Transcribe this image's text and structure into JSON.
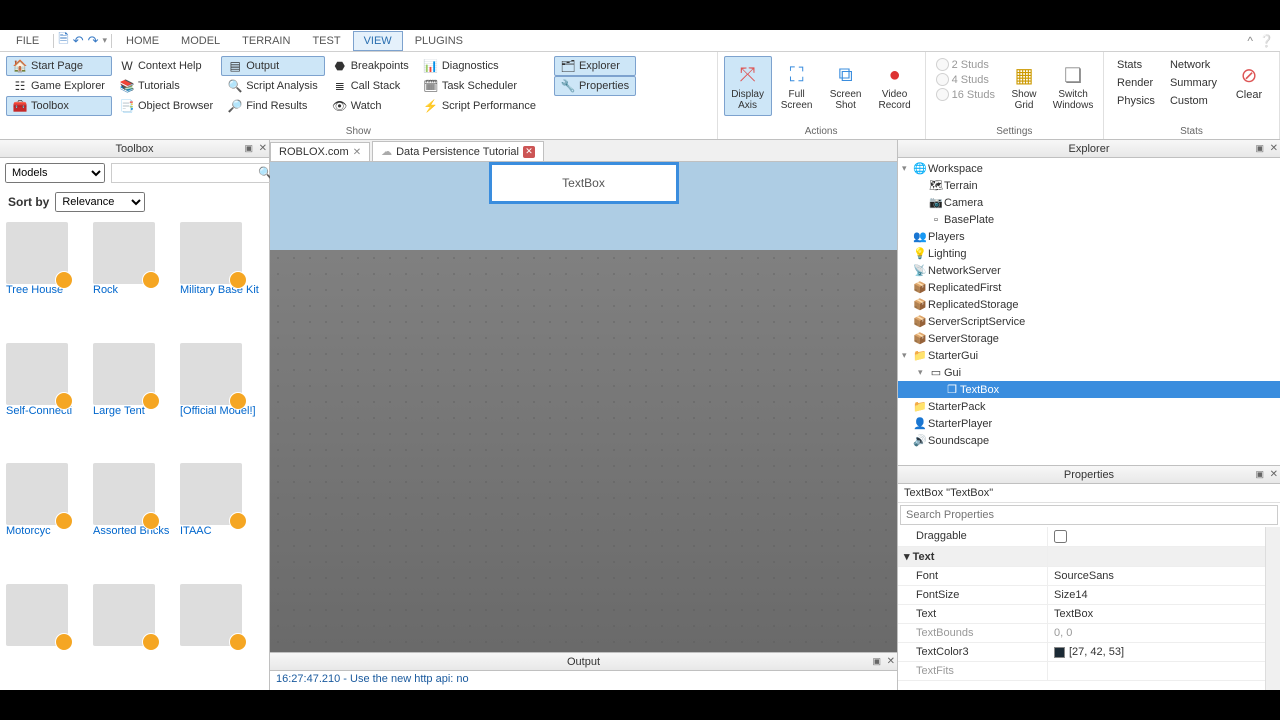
{
  "menu": {
    "file": "FILE",
    "home": "HOME",
    "model": "MODEL",
    "terrain": "TERRAIN",
    "test": "TEST",
    "view": "VIEW",
    "plugins": "PLUGINS"
  },
  "ribbon": {
    "show": {
      "label": "Show",
      "start_page": "Start Page",
      "context_help": "Context Help",
      "output": "Output",
      "breakpoints": "Breakpoints",
      "diagnostics": "Diagnostics",
      "game_explorer": "Game Explorer",
      "tutorials": "Tutorials",
      "script_analysis": "Script Analysis",
      "call_stack": "Call Stack",
      "task_scheduler": "Task Scheduler",
      "toolbox": "Toolbox",
      "object_browser": "Object Browser",
      "find_results": "Find Results",
      "watch": "Watch",
      "script_performance": "Script Performance",
      "explorer": "Explorer",
      "properties": "Properties"
    },
    "actions": {
      "label": "Actions",
      "display_axis": "Display\nAxis",
      "full_screen": "Full\nScreen",
      "screen_shot": "Screen\nShot",
      "video_record": "Video\nRecord"
    },
    "settings": {
      "label": "Settings",
      "studs2": "2 Studs",
      "studs4": "4 Studs",
      "studs16": "16 Studs",
      "show_grid": "Show\nGrid",
      "switch_windows": "Switch\nWindows"
    },
    "stats": {
      "label": "Stats",
      "stats": "Stats",
      "network": "Network",
      "render": "Render",
      "summary": "Summary",
      "physics": "Physics",
      "custom": "Custom",
      "clear": "Clear"
    }
  },
  "tabs": {
    "roblox": "ROBLOX.com",
    "tutorial": "Data Persistence Tutorial"
  },
  "toolbox": {
    "title": "Toolbox",
    "category": "Models",
    "sort_label": "Sort by",
    "sort_value": "Relevance",
    "items": [
      {
        "label": "Tree House"
      },
      {
        "label": "Rock"
      },
      {
        "label": "Military Base Kit"
      },
      {
        "label": "Self-Connecti"
      },
      {
        "label": "Large Tent"
      },
      {
        "label": "[Official Model!]"
      },
      {
        "label": "Motorcyc"
      },
      {
        "label": "Assorted Bricks"
      },
      {
        "label": "ITAAC"
      },
      {
        "label": ""
      },
      {
        "label": ""
      },
      {
        "label": ""
      }
    ]
  },
  "viewport": {
    "textbox": "TextBox"
  },
  "output": {
    "title": "Output",
    "line": "16:27:47.210 - Use the new http api: no"
  },
  "explorer": {
    "title": "Explorer",
    "tree": [
      {
        "label": "Workspace",
        "indent": 0,
        "arrow": "▾",
        "icon": "🌐"
      },
      {
        "label": "Terrain",
        "indent": 1,
        "arrow": "",
        "icon": "🗺"
      },
      {
        "label": "Camera",
        "indent": 1,
        "arrow": "",
        "icon": "📷"
      },
      {
        "label": "BasePlate",
        "indent": 1,
        "arrow": "",
        "icon": "▫"
      },
      {
        "label": "Players",
        "indent": 0,
        "arrow": "",
        "icon": "👥"
      },
      {
        "label": "Lighting",
        "indent": 0,
        "arrow": "",
        "icon": "💡"
      },
      {
        "label": "NetworkServer",
        "indent": 0,
        "arrow": "",
        "icon": "📡"
      },
      {
        "label": "ReplicatedFirst",
        "indent": 0,
        "arrow": "",
        "icon": "📦"
      },
      {
        "label": "ReplicatedStorage",
        "indent": 0,
        "arrow": "",
        "icon": "📦"
      },
      {
        "label": "ServerScriptService",
        "indent": 0,
        "arrow": "",
        "icon": "📦"
      },
      {
        "label": "ServerStorage",
        "indent": 0,
        "arrow": "",
        "icon": "📦"
      },
      {
        "label": "StarterGui",
        "indent": 0,
        "arrow": "▾",
        "icon": "📁"
      },
      {
        "label": "Gui",
        "indent": 1,
        "arrow": "▾",
        "icon": "▭"
      },
      {
        "label": "TextBox",
        "indent": 2,
        "arrow": "",
        "icon": "❐",
        "selected": true
      },
      {
        "label": "StarterPack",
        "indent": 0,
        "arrow": "",
        "icon": "📁"
      },
      {
        "label": "StarterPlayer",
        "indent": 0,
        "arrow": "",
        "icon": "👤"
      },
      {
        "label": "Soundscape",
        "indent": 0,
        "arrow": "",
        "icon": "🔊"
      }
    ]
  },
  "properties": {
    "title": "Properties",
    "object": "TextBox \"TextBox\"",
    "search_placeholder": "Search Properties",
    "rows": [
      {
        "k": "Draggable",
        "v": "",
        "checkbox": true
      },
      {
        "k": "Text",
        "v": "",
        "header": true
      },
      {
        "k": "Font",
        "v": "SourceSans"
      },
      {
        "k": "FontSize",
        "v": "Size14"
      },
      {
        "k": "Text",
        "v": "TextBox"
      },
      {
        "k": "TextBounds",
        "v": "0, 0",
        "ro": true
      },
      {
        "k": "TextColor3",
        "v": "[27, 42, 53]",
        "swatch": true
      },
      {
        "k": "TextFits",
        "v": "",
        "ro": true
      }
    ]
  }
}
